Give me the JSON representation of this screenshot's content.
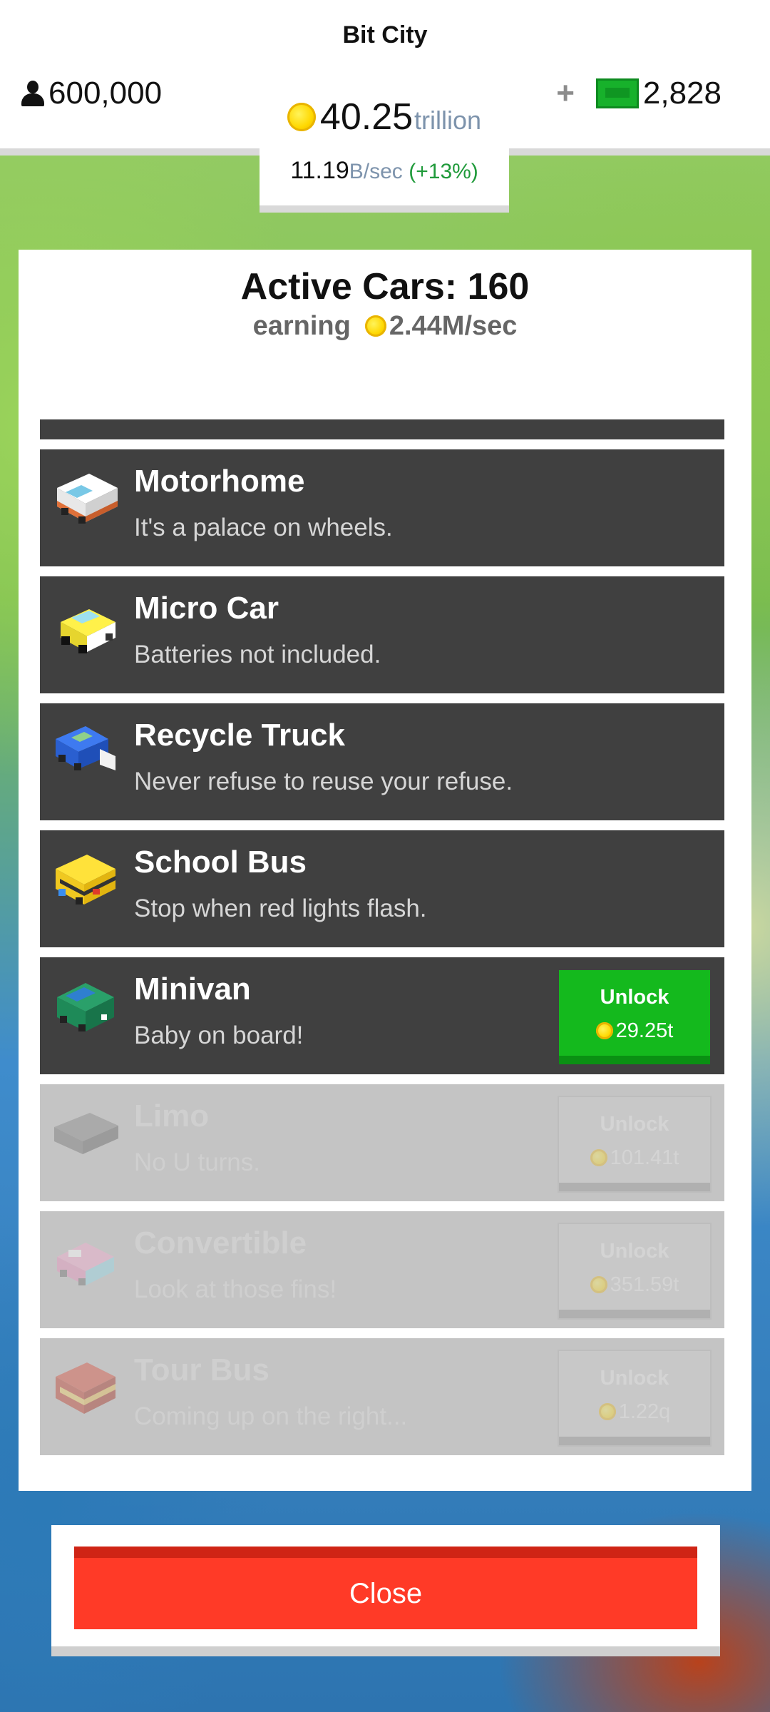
{
  "header": {
    "city_name": "Bit City",
    "population": "600,000",
    "coins": {
      "value": "40.25",
      "unit": "trillion"
    },
    "rate": {
      "value": "11.19",
      "unit": "B/sec",
      "bonus": "(+13%)"
    },
    "cash_plus": "+",
    "cash": "2,828"
  },
  "panel": {
    "title": "Active Cars: 160",
    "earning_label": "earning",
    "earning_value": "2.44M/sec"
  },
  "cars": [
    {
      "name": "Motorhome",
      "description": "It's a palace on wheels.",
      "icon": "motorhome-icon",
      "locked": false
    },
    {
      "name": "Micro Car",
      "description": "Batteries not included.",
      "icon": "micro-car-icon",
      "locked": false
    },
    {
      "name": "Recycle Truck",
      "description": "Never refuse to reuse your refuse.",
      "icon": "recycle-truck-icon",
      "locked": false
    },
    {
      "name": "School Bus",
      "description": "Stop when red lights flash.",
      "icon": "school-bus-icon",
      "locked": false
    },
    {
      "name": "Minivan",
      "description": "Baby on board!",
      "icon": "minivan-icon",
      "locked": false,
      "unlock_label": "Unlock",
      "price": "29.25t"
    },
    {
      "name": "Limo",
      "description": "No U turns.",
      "icon": "limo-icon",
      "locked": true,
      "unlock_label": "Unlock",
      "price": "101.41t"
    },
    {
      "name": "Convertible",
      "description": "Look at those fins!",
      "icon": "convertible-icon",
      "locked": true,
      "unlock_label": "Unlock",
      "price": "351.59t"
    },
    {
      "name": "Tour Bus",
      "description": "Coming up on the right...",
      "icon": "tour-bus-icon",
      "locked": true,
      "unlock_label": "Unlock",
      "price": "1.22q"
    }
  ],
  "close_label": "Close",
  "colors": {
    "unlock_green": "#14b91d",
    "close_red": "#ff3a27",
    "row_dark": "#404040",
    "row_locked": "#c4c4c4"
  }
}
